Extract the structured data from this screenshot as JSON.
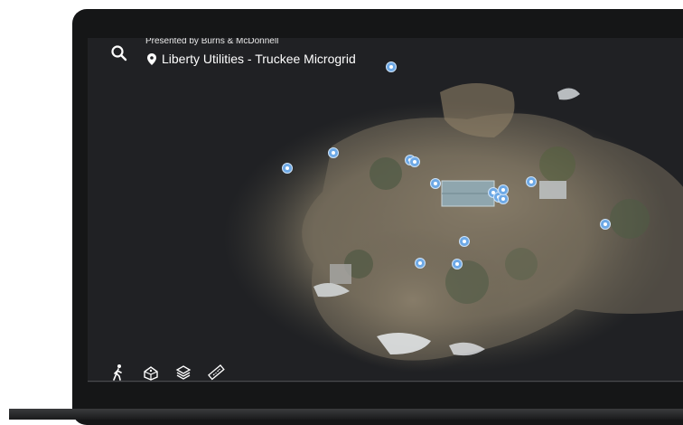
{
  "header": {
    "presented_by": "Presented by Burns & McDonnell",
    "title": "Liberty Utilities - Truckee Microgrid"
  },
  "icons": {
    "search": "search-icon",
    "location": "location-pin-icon",
    "walk": "walk-icon",
    "dollhouse": "dollhouse-icon",
    "floorplan": "layers-icon",
    "measure": "ruler-icon"
  },
  "colors": {
    "hotspot": "#6ea9e6",
    "screen_bg": "#202124",
    "frame": "#151617"
  },
  "hotspot_count": 15
}
